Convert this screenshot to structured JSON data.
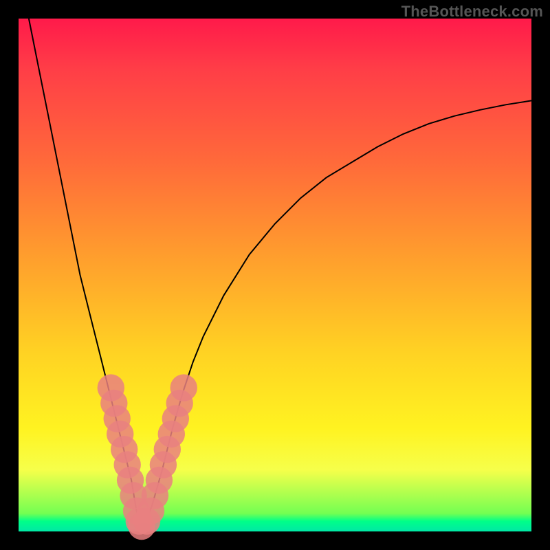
{
  "watermark": "TheBottleneck.com",
  "colors": {
    "frame": "#000000",
    "gradient_top": "#ff1a4a",
    "gradient_mid": "#ffd223",
    "gradient_bottom": "#00e8a6",
    "curve": "#000000",
    "marker": "#e98080"
  },
  "chart_data": {
    "type": "line",
    "title": "",
    "xlabel": "",
    "ylabel": "",
    "xlim": [
      0,
      100
    ],
    "ylim": [
      0,
      100
    ],
    "grid": false,
    "legend": false,
    "series": [
      {
        "name": "left-branch",
        "x": [
          2,
          4,
          6,
          8,
          10,
          12,
          14,
          16,
          18,
          19,
          20,
          21,
          22,
          22.5,
          23,
          23.5,
          24
        ],
        "y": [
          100,
          90,
          80,
          70,
          60,
          50,
          42,
          34,
          26,
          22,
          18,
          14,
          10,
          7,
          4,
          2,
          0
        ]
      },
      {
        "name": "right-branch",
        "x": [
          24,
          26,
          28,
          30,
          32,
          34,
          36,
          40,
          45,
          50,
          55,
          60,
          65,
          70,
          75,
          80,
          85,
          90,
          95,
          100
        ],
        "y": [
          0,
          5,
          12,
          20,
          27,
          33,
          38,
          46,
          54,
          60,
          65,
          69,
          72,
          75,
          77.5,
          79.5,
          81,
          82.2,
          83.2,
          84
        ]
      }
    ],
    "markers": [
      {
        "x": 18.0,
        "y": 28,
        "r": 2.2
      },
      {
        "x": 18.6,
        "y": 25,
        "r": 2.2
      },
      {
        "x": 19.2,
        "y": 22,
        "r": 2.2
      },
      {
        "x": 19.8,
        "y": 19,
        "r": 2.2
      },
      {
        "x": 20.6,
        "y": 16,
        "r": 2.2
      },
      {
        "x": 21.2,
        "y": 13,
        "r": 2.2
      },
      {
        "x": 21.8,
        "y": 10,
        "r": 2.2
      },
      {
        "x": 22.4,
        "y": 7,
        "r": 2.2
      },
      {
        "x": 23.0,
        "y": 4,
        "r": 2.2
      },
      {
        "x": 23.5,
        "y": 2,
        "r": 2.2
      },
      {
        "x": 24.0,
        "y": 1,
        "r": 2.2
      },
      {
        "x": 25.0,
        "y": 2,
        "r": 2.2
      },
      {
        "x": 25.8,
        "y": 4,
        "r": 2.2
      },
      {
        "x": 26.6,
        "y": 7,
        "r": 2.2
      },
      {
        "x": 27.4,
        "y": 10,
        "r": 2.2
      },
      {
        "x": 28.2,
        "y": 13,
        "r": 2.2
      },
      {
        "x": 29.0,
        "y": 16,
        "r": 2.2
      },
      {
        "x": 29.8,
        "y": 19,
        "r": 2.2
      },
      {
        "x": 30.6,
        "y": 22,
        "r": 2.2
      },
      {
        "x": 31.4,
        "y": 25,
        "r": 2.2
      },
      {
        "x": 32.2,
        "y": 28,
        "r": 2.2
      }
    ]
  }
}
